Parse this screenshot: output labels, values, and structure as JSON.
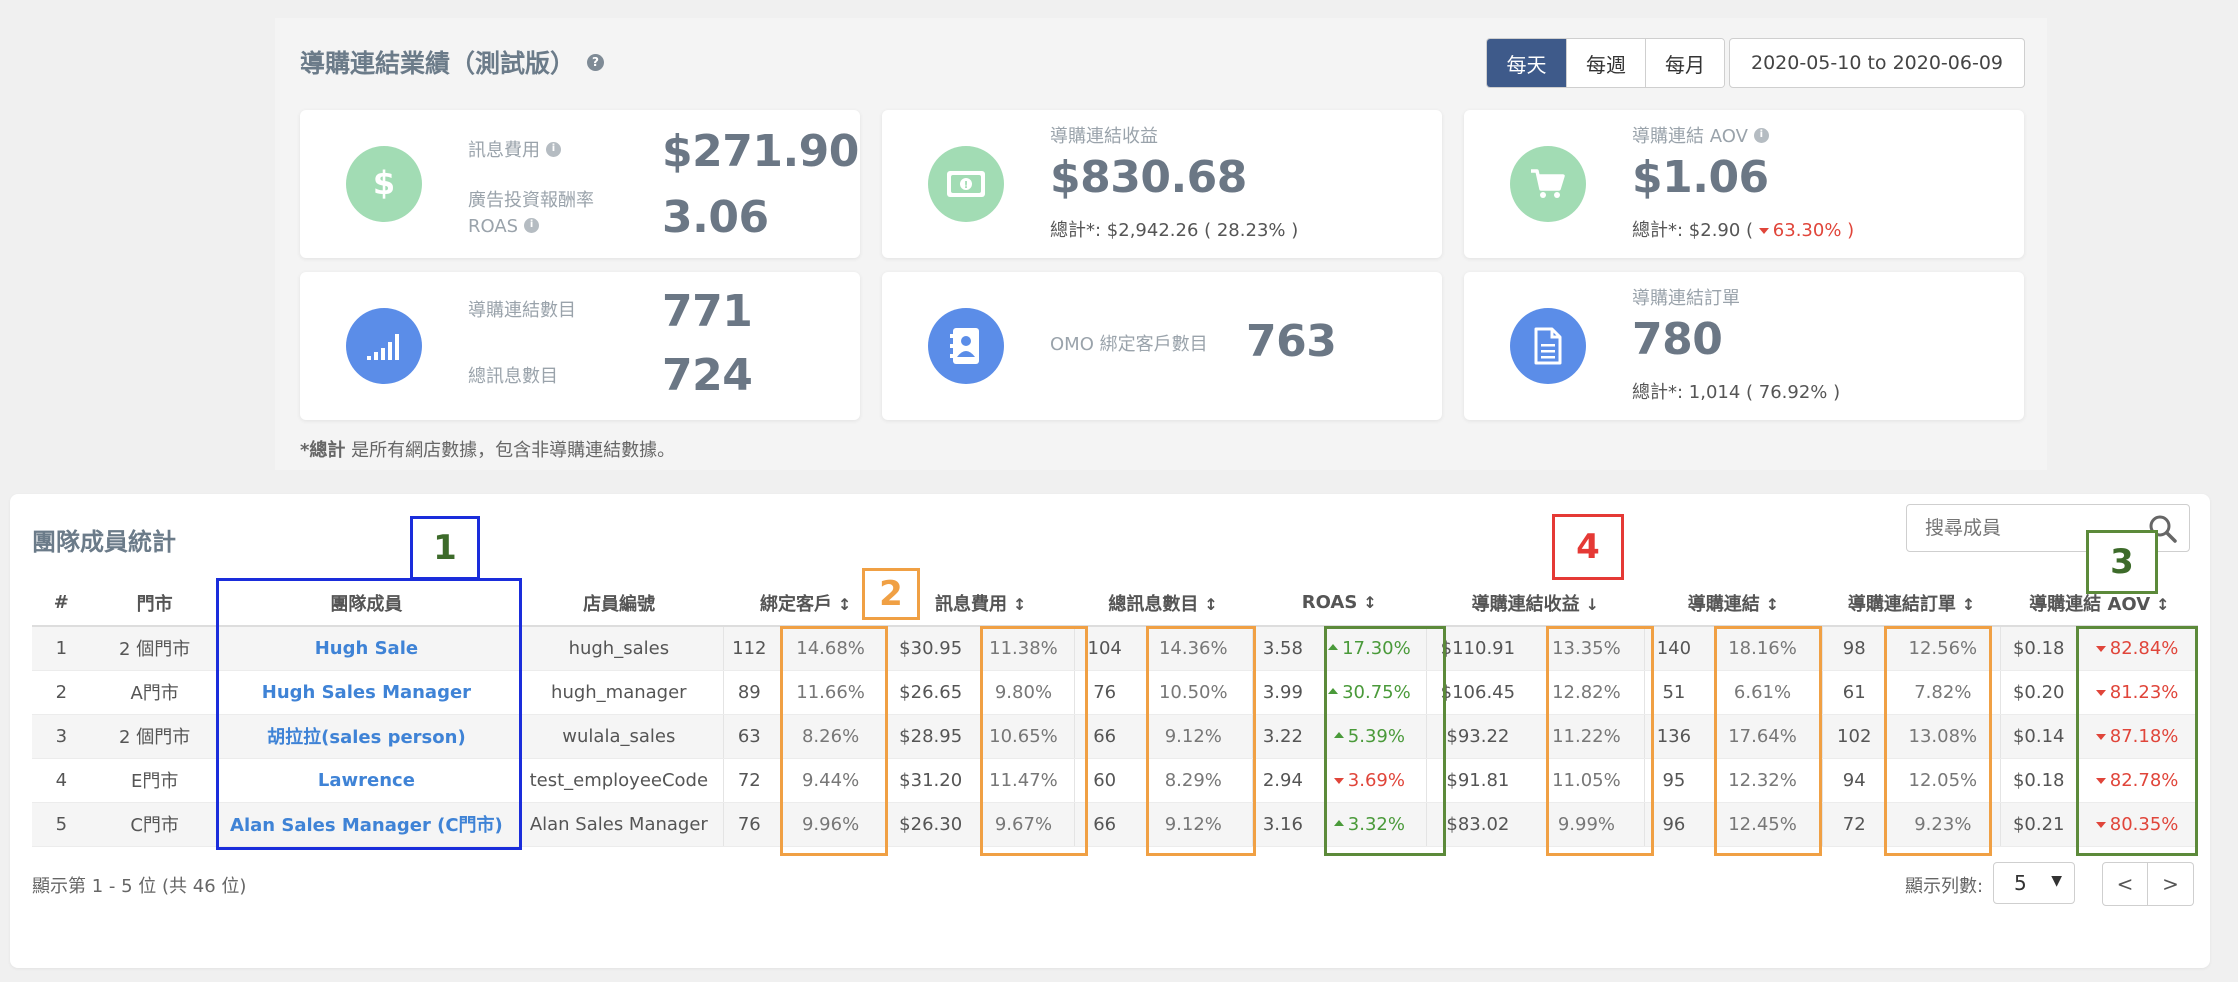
{
  "header": {
    "title": "導購連結業績（測試版）",
    "periods": [
      "每天",
      "每週",
      "每月"
    ],
    "active_period": "每天",
    "date_range": "2020-05-10 to 2020-06-09"
  },
  "cards": {
    "cost": {
      "label1": "訊息費用",
      "value1": "$271.90",
      "label2a": "廣告投資報酬率",
      "label2b": "ROAS",
      "value2": "3.06"
    },
    "revenue": {
      "label": "導購連結收益",
      "value": "$830.68",
      "total": "總計*: $2,942.26 ( 28.23% )"
    },
    "aov": {
      "label": "導購連結 AOV",
      "value": "$1.06",
      "total_prefix": "總計*: $2.90 (",
      "total_neg": "63.30%",
      "total_suffix": " )"
    },
    "links": {
      "label1": "導購連結數目",
      "value1": "771",
      "label2": "總訊息數目",
      "value2": "724"
    },
    "omo": {
      "label": "OMO 綁定客戶數目",
      "value": "763"
    },
    "orders": {
      "label": "導購連結訂單",
      "value": "780",
      "total": "總計*: 1,014 ( 76.92% )"
    }
  },
  "footnote": {
    "bold": "*總計",
    "text": " 是所有網店數據，包含非導購連結數據。"
  },
  "team": {
    "title": "團隊成員統計",
    "search_placeholder": "搜尋成員",
    "columns": [
      "#",
      "門市",
      "團隊成員",
      "店員編號",
      "綁定客戶",
      "訊息費用",
      "總訊息數目",
      "ROAS",
      "導購連結收益",
      "導購連結",
      "導購連結訂單",
      "導購連結 AOV"
    ],
    "rows": [
      {
        "n": "1",
        "store": "2 個門市",
        "member": "Hugh Sale",
        "code": "hugh_sales",
        "cust": "112",
        "cust_pct": "14.68%",
        "cost": "$30.95",
        "cost_pct": "11.38%",
        "msgs": "104",
        "msgs_pct": "14.36%",
        "roas": "3.58",
        "roas_chg": "17.30%",
        "roas_dir": "up",
        "rev": "$110.91",
        "rev_pct": "13.35%",
        "links": "140",
        "links_pct": "18.16%",
        "orders": "98",
        "orders_pct": "12.56%",
        "aov": "$0.18",
        "aov_chg": "82.84%",
        "aov_dir": "down"
      },
      {
        "n": "2",
        "store": "A門市",
        "member": "Hugh Sales Manager",
        "code": "hugh_manager",
        "cust": "89",
        "cust_pct": "11.66%",
        "cost": "$26.65",
        "cost_pct": "9.80%",
        "msgs": "76",
        "msgs_pct": "10.50%",
        "roas": "3.99",
        "roas_chg": "30.75%",
        "roas_dir": "up",
        "rev": "$106.45",
        "rev_pct": "12.82%",
        "links": "51",
        "links_pct": "6.61%",
        "orders": "61",
        "orders_pct": "7.82%",
        "aov": "$0.20",
        "aov_chg": "81.23%",
        "aov_dir": "down"
      },
      {
        "n": "3",
        "store": "2 個門市",
        "member": "胡拉拉(sales person)",
        "code": "wulala_sales",
        "cust": "63",
        "cust_pct": "8.26%",
        "cost": "$28.95",
        "cost_pct": "10.65%",
        "msgs": "66",
        "msgs_pct": "9.12%",
        "roas": "3.22",
        "roas_chg": "5.39%",
        "roas_dir": "up",
        "rev": "$93.22",
        "rev_pct": "11.22%",
        "links": "136",
        "links_pct": "17.64%",
        "orders": "102",
        "orders_pct": "13.08%",
        "aov": "$0.14",
        "aov_chg": "87.18%",
        "aov_dir": "down"
      },
      {
        "n": "4",
        "store": "E門市",
        "member": "Lawrence",
        "code": "test_employeeCode",
        "cust": "72",
        "cust_pct": "9.44%",
        "cost": "$31.20",
        "cost_pct": "11.47%",
        "msgs": "60",
        "msgs_pct": "8.29%",
        "roas": "2.94",
        "roas_chg": "3.69%",
        "roas_dir": "down",
        "rev": "$91.81",
        "rev_pct": "11.05%",
        "links": "95",
        "links_pct": "12.32%",
        "orders": "94",
        "orders_pct": "12.05%",
        "aov": "$0.18",
        "aov_chg": "82.78%",
        "aov_dir": "down"
      },
      {
        "n": "5",
        "store": "C門市",
        "member": "Alan Sales Manager (C門市)",
        "code": "Alan Sales Manager",
        "cust": "76",
        "cust_pct": "9.96%",
        "cost": "$26.30",
        "cost_pct": "9.67%",
        "msgs": "66",
        "msgs_pct": "9.12%",
        "roas": "3.16",
        "roas_chg": "3.32%",
        "roas_dir": "up",
        "rev": "$83.02",
        "rev_pct": "9.99%",
        "links": "96",
        "links_pct": "12.45%",
        "orders": "72",
        "orders_pct": "9.23%",
        "aov": "$0.21",
        "aov_chg": "80.35%",
        "aov_dir": "down"
      }
    ],
    "footer_info": "顯示第 1 - 5 位 (共 46 位)",
    "rows_label": "顯示列數:",
    "rows_value": "5",
    "prev": "<",
    "next": ">"
  },
  "annotations": [
    "1",
    "2",
    "3",
    "4"
  ],
  "colors": {
    "primary": "#3e5a8a",
    "link": "#3f83d6",
    "negative": "#e0453a",
    "positive": "#4a9a3a",
    "card_green": "#a2dcb4",
    "card_blue": "#5b8de8"
  },
  "icons": [
    "help-icon",
    "dollar-icon",
    "money-icon",
    "cart-icon",
    "signal-icon",
    "contact-icon",
    "document-icon",
    "sort-icon",
    "sort-desc-icon",
    "search-icon",
    "chevron-down-icon"
  ]
}
